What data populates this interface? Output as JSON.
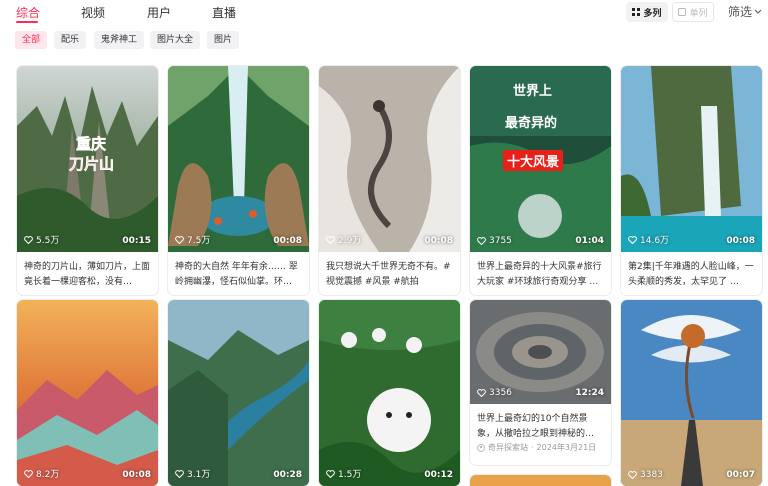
{
  "top_tabs": [
    "综合",
    "视频",
    "用户",
    "直播"
  ],
  "view_switch": {
    "grid_label": "多列",
    "single_label": "单列"
  },
  "filter_label": "筛选",
  "chips": [
    "全部",
    "配乐",
    "鬼斧神工",
    "图片大全",
    "图片"
  ],
  "cards": [
    {
      "likes": "5.5万",
      "duration": "00:15",
      "desc": "神奇的刀片山，薄如刀片，上面竟长着一棵迎客松，没有…",
      "overlay": "重庆刀片山"
    },
    {
      "likes": "7.5万",
      "duration": "00:08",
      "desc": "神奇的大自然 年年有余…… 翠岭拥幽瀑，怪石似仙掌。环…",
      "overlay": ""
    },
    {
      "likes": "2.9万",
      "duration": "00:08",
      "desc": "我只想说大千世界无奇不有。#视觉震撼 #风景 #航拍",
      "overlay": ""
    },
    {
      "likes": "3755",
      "duration": "01:04",
      "desc": "世界上最奇异的十大风景#旅行大玩家 #环球旅行奇观分享 …",
      "overlay_line1": "世界上",
      "overlay_line2": "最奇异的",
      "overlay_line3": "十大风景"
    },
    {
      "likes": "14.6万",
      "duration": "00:08",
      "desc": "第2集|千年难遇的人脸山峰，一头柔顺的秀发，太罕见了 …",
      "overlay": ""
    },
    {
      "likes": "8.2万",
      "duration": "00:08",
      "desc": "",
      "overlay": ""
    },
    {
      "likes": "3.1万",
      "duration": "00:28",
      "desc": "",
      "overlay": ""
    },
    {
      "likes": "1.5万",
      "duration": "00:12",
      "desc": "",
      "overlay": ""
    },
    {
      "likes": "3356",
      "duration": "12:24",
      "desc": "世界上最奇幻的10个自然景象，从撒哈拉之眼到神秘的…",
      "author": "奇异探索站",
      "date": "2024年3月21日"
    },
    {
      "likes": "3383",
      "duration": "00:07",
      "desc": "",
      "overlay": ""
    }
  ],
  "colors": {
    "accent": "#fe2c55",
    "chip_bg": "#f2f2f4",
    "active_chip_bg": "#fde7ec"
  }
}
